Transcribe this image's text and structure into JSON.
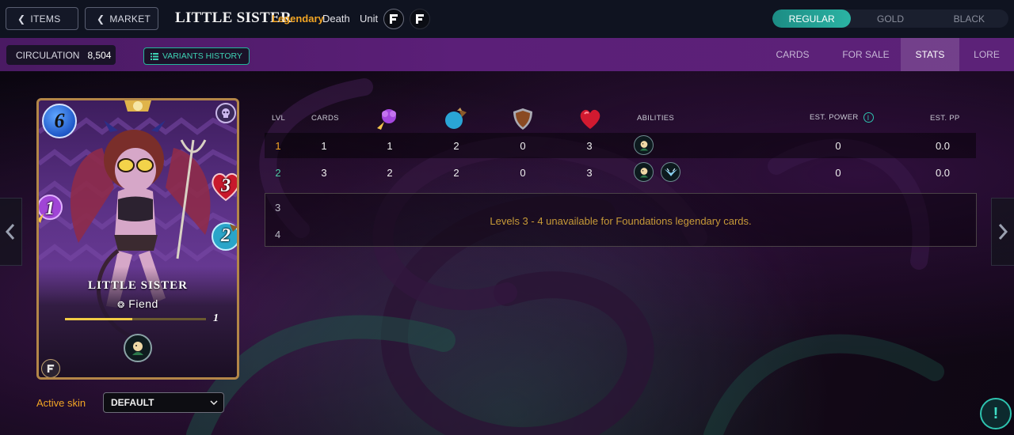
{
  "nav": {
    "items_label": "ITEMS",
    "market_label": "MARKET"
  },
  "card_header": {
    "name": "LITTLE SISTER",
    "rarity": "Legendary",
    "element": "Death",
    "type": "Unit"
  },
  "foil_toggle": {
    "options": [
      "REGULAR",
      "GOLD",
      "BLACK"
    ],
    "selected": "REGULAR"
  },
  "circulation": {
    "label": "CIRCULATION",
    "value": "8,504"
  },
  "variants_history_label": "VARIANTS HISTORY",
  "tabs": [
    {
      "label": "CARDS",
      "active": false
    },
    {
      "label": "FOR SALE",
      "active": false
    },
    {
      "label": "STATS",
      "active": true
    },
    {
      "label": "LORE",
      "active": false
    }
  ],
  "card": {
    "name": "LITTLE SISTER",
    "type": "Fiend",
    "mana": "6",
    "magic": "1",
    "speed": "2",
    "health": "3",
    "level": "1",
    "xp_progress": 0.48
  },
  "active_skin": {
    "label": "Active skin",
    "value": "DEFAULT"
  },
  "stats_table": {
    "headers": {
      "lvl": "LVL",
      "cards": "CARDS",
      "abilities": "ABILITIES",
      "est_power": "EST. POWER",
      "est_pp": "EST. PP"
    },
    "stat_icons": [
      "magic-attack-icon",
      "speed-icon",
      "armor-icon",
      "health-icon"
    ],
    "rows": [
      {
        "lvl": "1",
        "cards": "1",
        "magic": "1",
        "speed": "2",
        "armor": "0",
        "health": "3",
        "abilities": [
          "ability-icon-1"
        ],
        "est_power": "0",
        "est_pp": "0.0"
      },
      {
        "lvl": "2",
        "cards": "3",
        "magic": "2",
        "speed": "2",
        "armor": "0",
        "health": "3",
        "abilities": [
          "ability-icon-1",
          "ability-icon-2"
        ],
        "est_power": "0",
        "est_pp": "0.0"
      }
    ],
    "unavailable_levels": [
      "3",
      "4"
    ],
    "unavailable_message": "Levels 3 - 4 unavailable for Foundations legendary cards."
  },
  "help_button": "!",
  "colors": {
    "accent_orange": "#f2a524",
    "teal": "#2bb3a3",
    "purple_bar": "#5b1f78"
  }
}
